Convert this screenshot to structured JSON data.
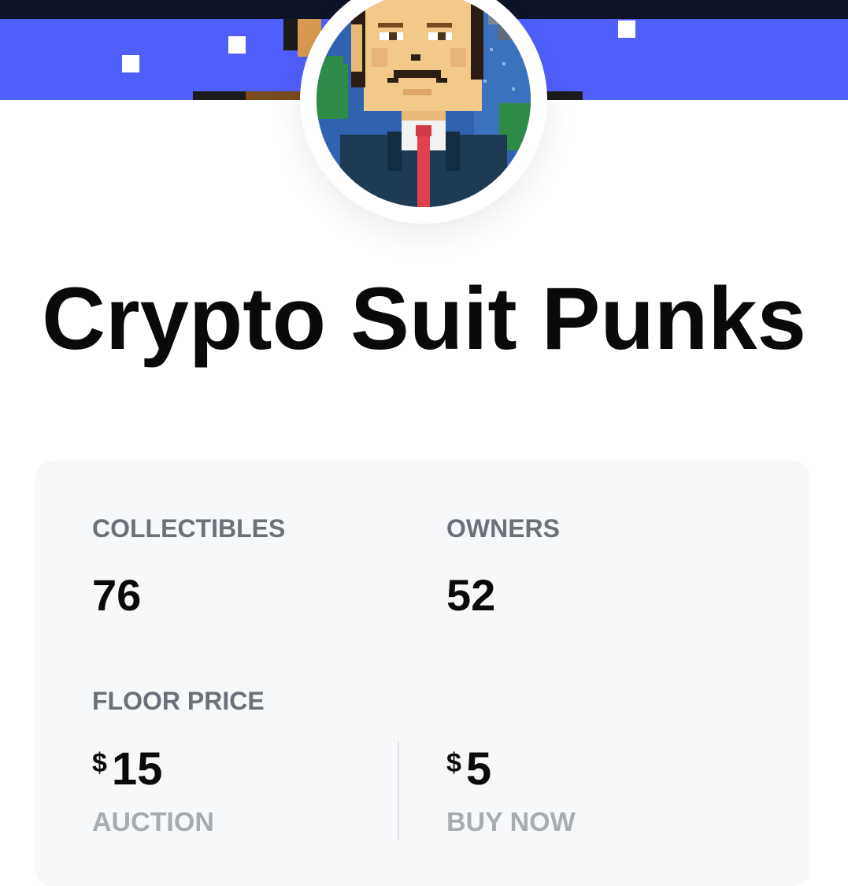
{
  "collection": {
    "title": "Crypto Suit Punks",
    "avatar_icon": "pixel-art-punk-in-suit",
    "banner_color": "#4f5ffb"
  },
  "stats": {
    "collectibles_label": "COLLECTIBLES",
    "collectibles_value": "76",
    "owners_label": "OWNERS",
    "owners_value": "52",
    "floor_price_label": "FLOOR PRICE",
    "auction": {
      "currency": "$",
      "amount": "15",
      "label": "AUCTION"
    },
    "buy_now": {
      "currency": "$",
      "amount": "5",
      "label": "BUY NOW"
    }
  }
}
